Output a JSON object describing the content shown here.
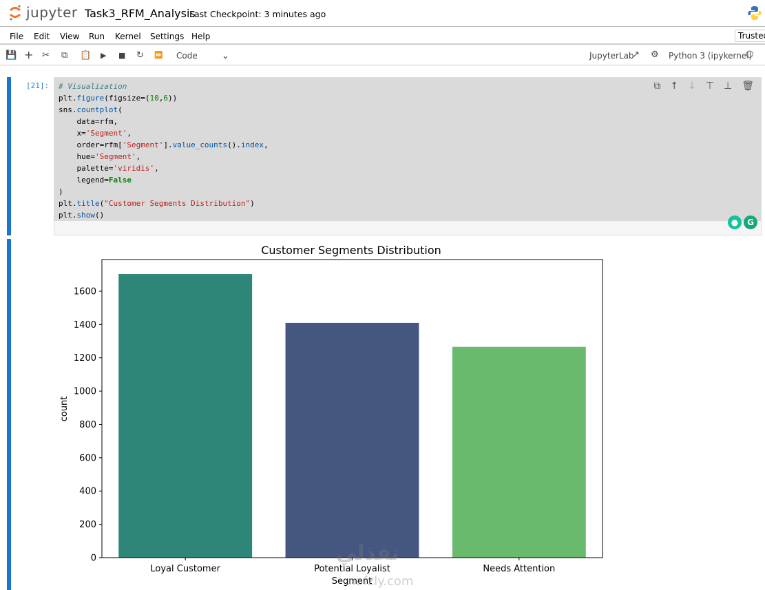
{
  "header": {
    "logo_text": "jupyter",
    "notebook_title": "Task3_RFM_Analysis",
    "checkpoint": "Last Checkpoint: 3 minutes ago"
  },
  "menu": [
    "File",
    "Edit",
    "View",
    "Run",
    "Kernel",
    "Settings",
    "Help"
  ],
  "trusted": "Trusted",
  "toolbar": {
    "cell_type": "Code",
    "jupyterlab": "JupyterLab",
    "kernel": "Python 3 (ipykernel)"
  },
  "cell": {
    "prompt": "[21]:"
  },
  "watermark": {
    "text": "نفذلي",
    "sub": "nafzly.com"
  },
  "chart_data": {
    "type": "bar",
    "title": "Customer Segments Distribution",
    "xlabel": "Segment",
    "ylabel": "count",
    "categories": [
      "Loyal Customer",
      "Potential Loyalist",
      "Needs Attention"
    ],
    "values": [
      1703,
      1410,
      1266
    ],
    "colors": [
      "#2e8679",
      "#455681",
      "#6aba6e"
    ],
    "ylim": [
      0,
      1790
    ],
    "yticks": [
      0,
      200,
      400,
      600,
      800,
      1000,
      1200,
      1400,
      1600
    ],
    "grid": false,
    "legend": false
  }
}
